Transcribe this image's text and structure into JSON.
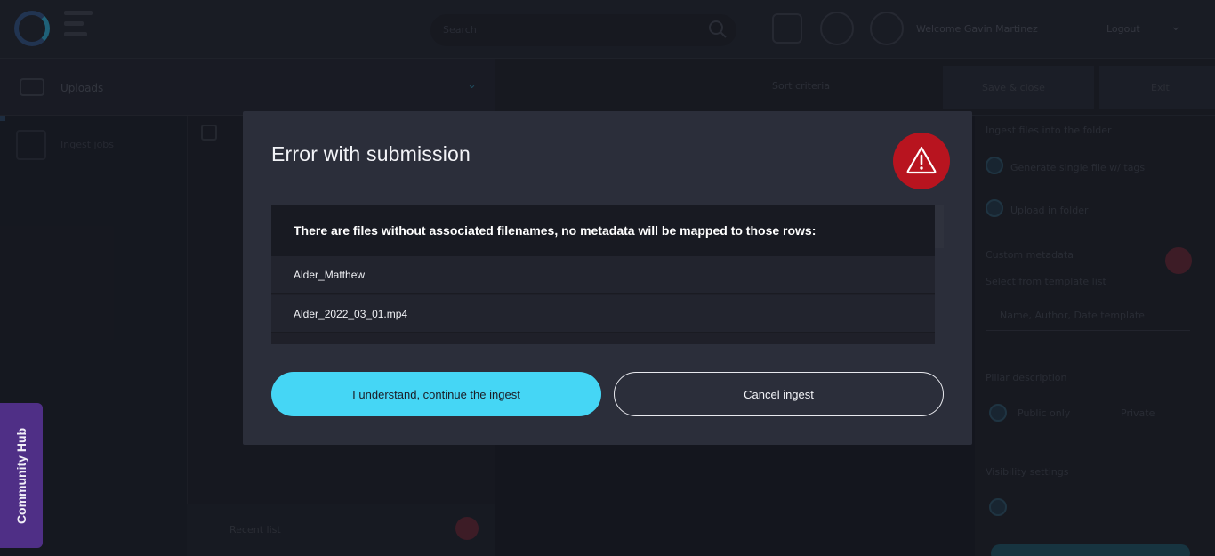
{
  "background": {
    "search_placeholder": "Search",
    "welcome_text": "Welcome Gavin Martinez",
    "user_menu": "Logout",
    "sidebar_header": "Uploads",
    "sidebar_item": "Ingest jobs",
    "mid_bottom": "Recent list",
    "main_chip": "Sort criteria",
    "main_button": "Save & close",
    "main_button2": "Exit",
    "right_panel": {
      "lines": [
        "Ingest files into the folder",
        "Generate single file w/ tags",
        "Upload in folder",
        "Custom metadata",
        "Select from template list",
        "Pillar description",
        "Visibility settings",
        "Public only",
        "Private"
      ],
      "select_value": "Name, Author, Date template"
    }
  },
  "community_hub": {
    "label": "Community Hub"
  },
  "modal": {
    "title": "Error with submission",
    "warning_icon": "warning-triangle-icon",
    "message": "There are files without associated filenames, no metadata will be mapped to those rows:",
    "files": [
      "Alder_Matthew",
      "Alder_2022_03_01.mp4"
    ],
    "continue_label": "I understand, continue the ingest",
    "cancel_label": "Cancel ingest"
  },
  "colors": {
    "accent": "#45d6f5",
    "danger": "#b8141f",
    "community_hub": "#4f2f86",
    "modal_bg": "#2b2e3a"
  }
}
